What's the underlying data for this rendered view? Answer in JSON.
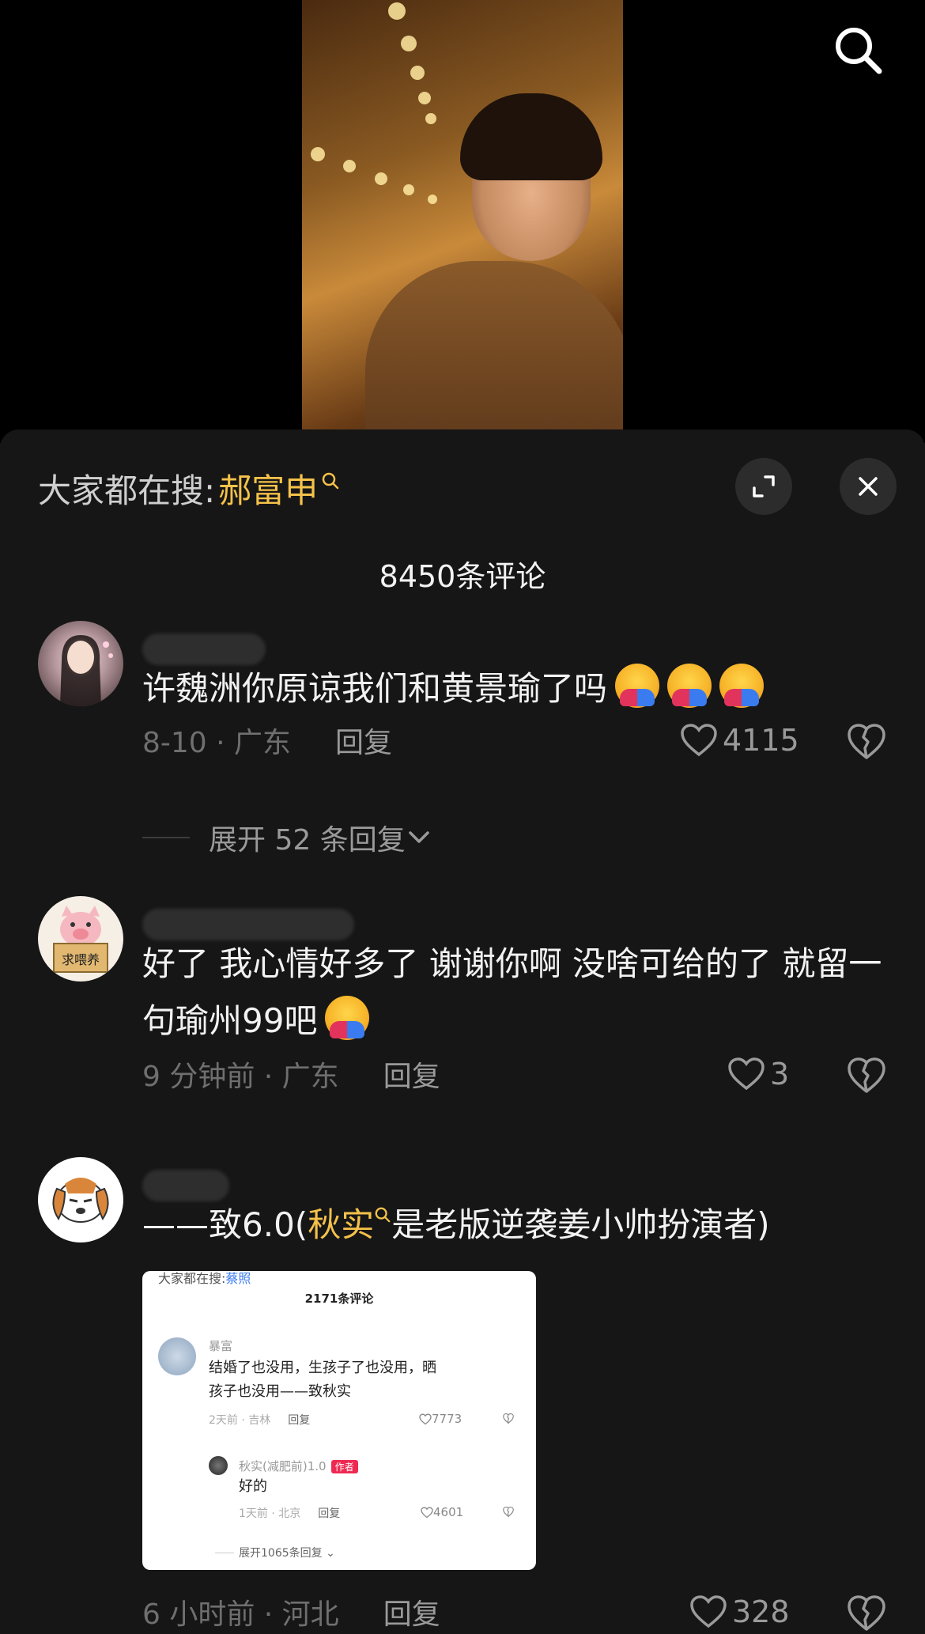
{
  "video": {
    "search_icon": "search-icon"
  },
  "panel": {
    "hot_search_prefix": "大家都在搜:",
    "hot_search_term": "郝富申",
    "expand_icon": "fullscreen-icon",
    "close_icon": "close-icon",
    "comment_count": "8450条评论"
  },
  "comments": [
    {
      "text": "许魏洲你原谅我们和黄景瑜了吗",
      "emoji_count": 3,
      "meta": "8-10 · 广东",
      "reply": "回复",
      "likes": "4115",
      "expand": "展开 52 条回复"
    },
    {
      "text": "好了 我心情好多了 谢谢你啊 没啥可给的了 就留一句瑜州99吧",
      "meta": "9 分钟前 · 广东",
      "reply": "回复",
      "likes": "3"
    },
    {
      "text_before": "——致6.0(",
      "hot_term": "秋实",
      "text_after": "是老版逆袭姜小帅扮演者)",
      "meta": "6 小时前 · 河北",
      "reply": "回复",
      "likes": "328"
    }
  ],
  "card": {
    "top_prefix": "大家都在搜:",
    "top_term": "蔡照",
    "count": "2171条评论",
    "c1_name": "暴富",
    "c1_text": "结婚了也没用，生孩子了也没用，晒孩子也没用——致秋实",
    "c1_meta": "2天前 · 吉林",
    "c1_reply": "回复",
    "c1_likes": "7773",
    "c2_name": "秋实(减肥前)1.0",
    "c2_tag": "作者",
    "c2_text": "好的",
    "c2_meta": "1天前 · 北京",
    "c2_reply": "回复",
    "c2_likes": "4601",
    "expand": "展开1065条回复"
  }
}
